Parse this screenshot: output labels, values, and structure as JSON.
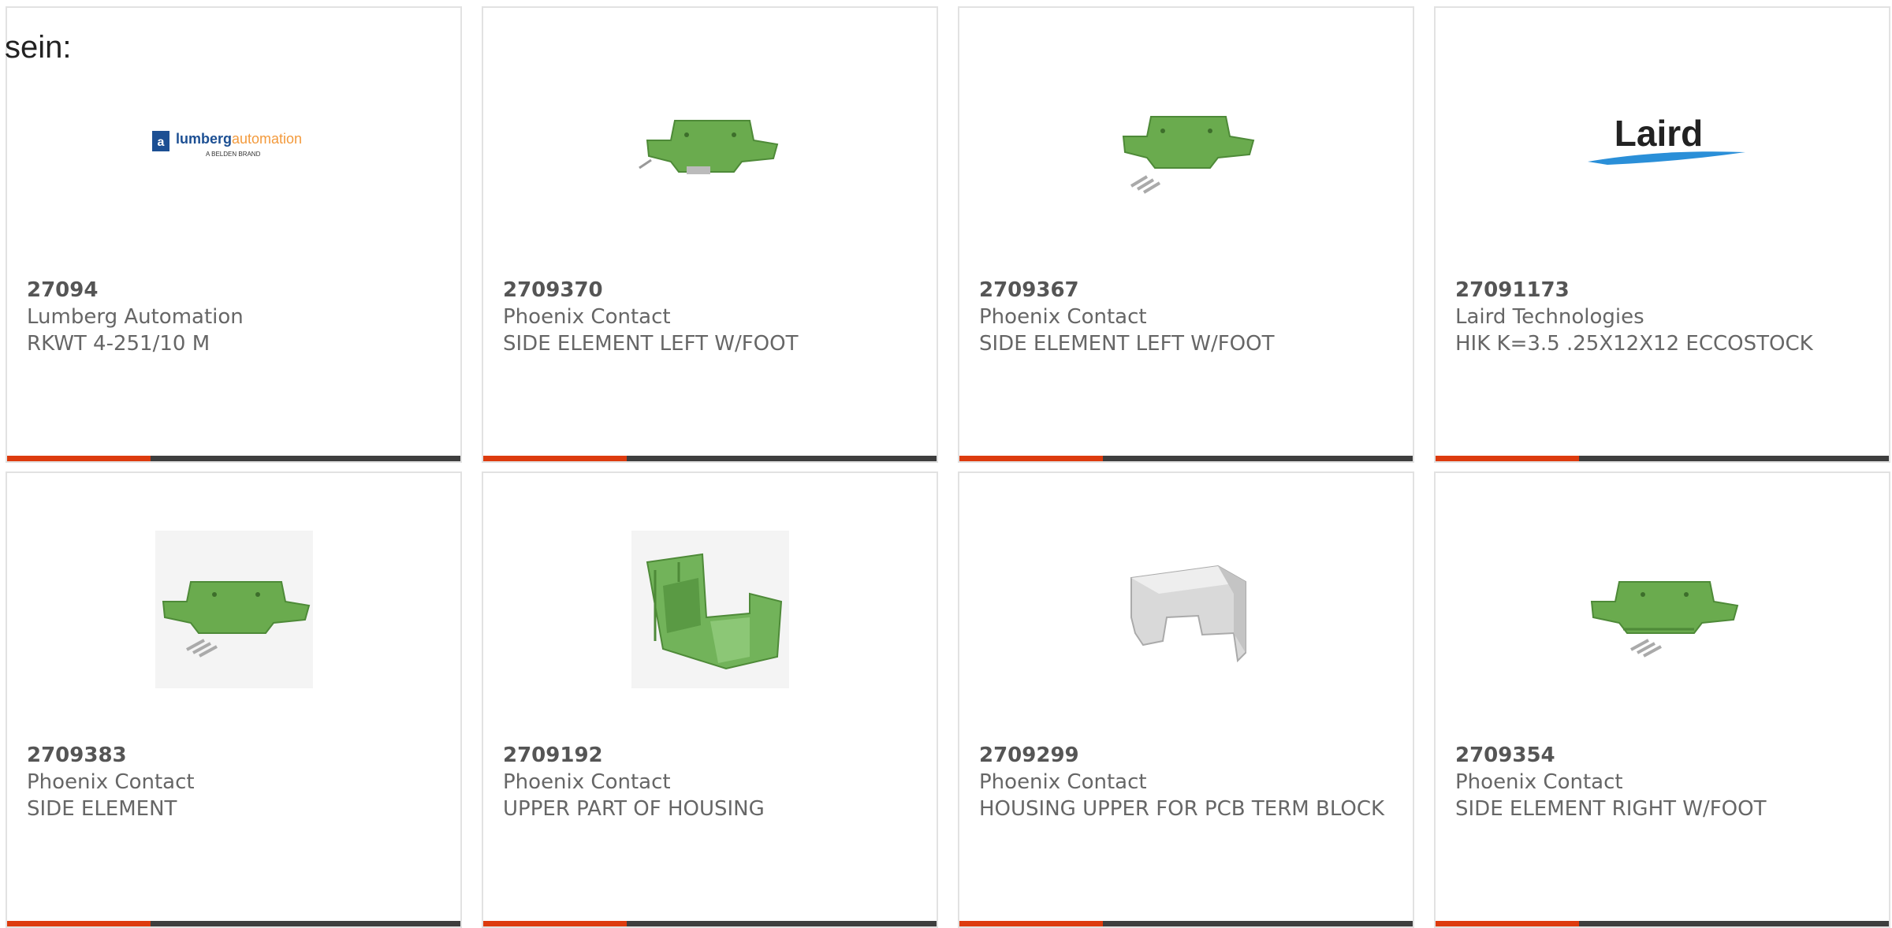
{
  "intro_text": "sein:",
  "colors": {
    "accent": "#dd3b0e",
    "bar": "#3e3e3e",
    "part_green": "#6aab4e",
    "housing_grey": "#d4d4d4"
  },
  "products": [
    {
      "part": "27094",
      "manufacturer": "Lumberg Automation",
      "description": "RKWT 4-251/10 M",
      "image": "lumberg-automation-logo",
      "logo": {
        "brand_a": "lumberg",
        "brand_b": "automation",
        "tagline": "A BELDEN BRAND"
      }
    },
    {
      "part": "2709370",
      "manufacturer": "Phoenix Contact",
      "description": "SIDE ELEMENT LEFT W/FOOT",
      "image": "green-side-element-photo"
    },
    {
      "part": "2709367",
      "manufacturer": "Phoenix Contact",
      "description": "SIDE ELEMENT LEFT W/FOOT",
      "image": "green-side-element-photo"
    },
    {
      "part": "27091173",
      "manufacturer": "Laird Technologies",
      "description": "HIK K=3.5 .25X12X12 ECCOSTOCK",
      "image": "laird-logo",
      "logo": {
        "text": "Laird"
      }
    },
    {
      "part": "2709383",
      "manufacturer": "Phoenix Contact",
      "description": "SIDE ELEMENT",
      "image": "green-side-element-photo"
    },
    {
      "part": "2709192",
      "manufacturer": "Phoenix Contact",
      "description": "UPPER PART OF HOUSING",
      "image": "green-housing-photo"
    },
    {
      "part": "2709299",
      "manufacturer": "Phoenix Contact",
      "description": "HOUSING UPPER FOR PCB TERM BLOCK",
      "image": "grey-housing-photo"
    },
    {
      "part": "2709354",
      "manufacturer": "Phoenix Contact",
      "description": "SIDE ELEMENT RIGHT W/FOOT",
      "image": "green-side-element-photo"
    }
  ]
}
